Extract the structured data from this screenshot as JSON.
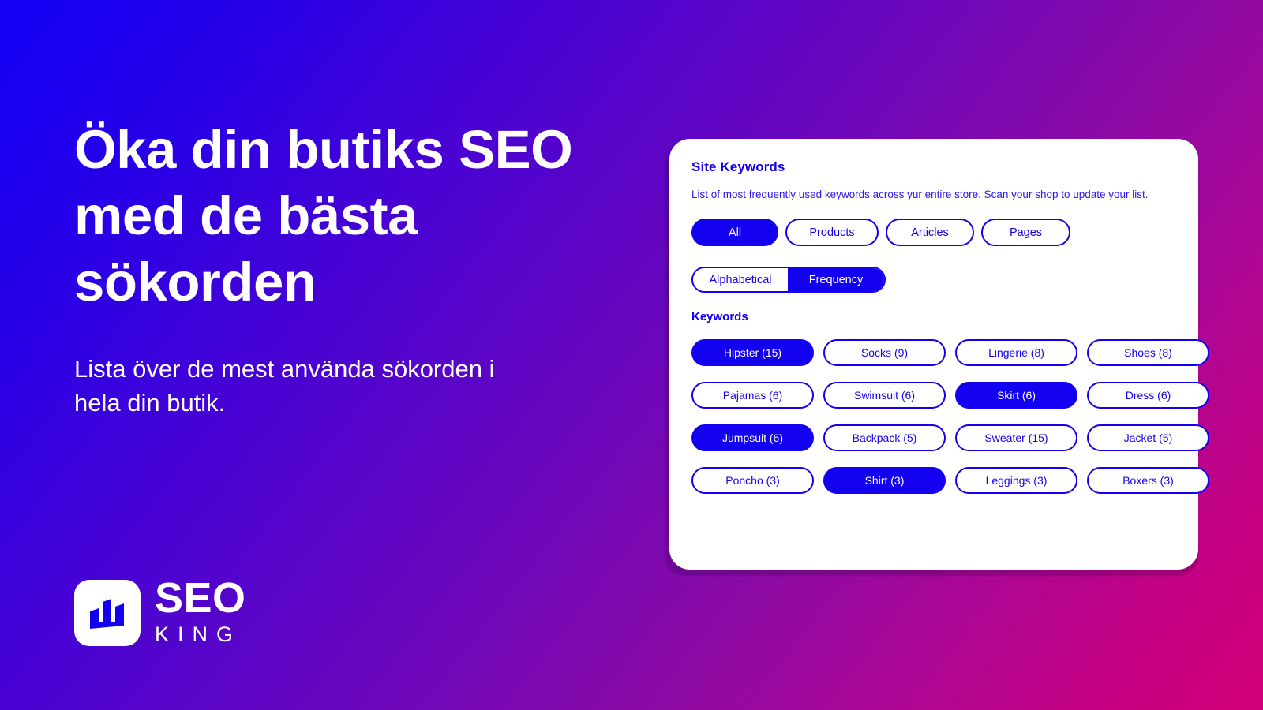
{
  "theme": {
    "accent_blue": "#1400F0",
    "gradient_start": "#1200F6",
    "gradient_mid": "#6A07BD",
    "gradient_end": "#D2007A",
    "card_background": "#FFFFFF",
    "text_white": "#FFFFFF"
  },
  "hero": {
    "headline": "Öka din butiks SEO med de bästa sökorden",
    "subheadline": "Lista över de mest använda sökorden i hela din butik."
  },
  "logo": {
    "mark_icon": "bar-chart-icon",
    "primary_text": "SEO",
    "secondary_text": "KING"
  },
  "card": {
    "title": "Site Keywords",
    "description": "List of most frequently used keywords across yur entire store. Scan your shop to update your list.",
    "filters": [
      {
        "label": "All",
        "active": true
      },
      {
        "label": "Products",
        "active": false
      },
      {
        "label": "Articles",
        "active": false
      },
      {
        "label": "Pages",
        "active": false
      }
    ],
    "sort": [
      {
        "label": "Alphabetical",
        "active": false
      },
      {
        "label": "Frequency",
        "active": true
      }
    ],
    "keywords_label": "Keywords",
    "keywords": [
      {
        "label": "Hipster (15)",
        "term": "Hipster",
        "count": 15,
        "selected": true
      },
      {
        "label": "Socks (9)",
        "term": "Socks",
        "count": 9,
        "selected": false
      },
      {
        "label": "Lingerie (8)",
        "term": "Lingerie",
        "count": 8,
        "selected": false
      },
      {
        "label": "Shoes (8)",
        "term": "Shoes",
        "count": 8,
        "selected": false
      },
      {
        "label": "Pajamas (6)",
        "term": "Pajamas",
        "count": 6,
        "selected": false
      },
      {
        "label": "Swimsuit (6)",
        "term": "Swimsuit",
        "count": 6,
        "selected": false
      },
      {
        "label": "Skirt (6)",
        "term": "Skirt",
        "count": 6,
        "selected": true
      },
      {
        "label": "Dress (6)",
        "term": "Dress",
        "count": 6,
        "selected": false
      },
      {
        "label": "Jumpsuit (6)",
        "term": "Jumpsuit",
        "count": 6,
        "selected": true
      },
      {
        "label": "Backpack (5)",
        "term": "Backpack",
        "count": 5,
        "selected": false
      },
      {
        "label": "Sweater (15)",
        "term": "Sweater",
        "count": 15,
        "selected": false
      },
      {
        "label": "Jacket (5)",
        "term": "Jacket",
        "count": 5,
        "selected": false
      },
      {
        "label": "Poncho (3)",
        "term": "Poncho",
        "count": 3,
        "selected": false
      },
      {
        "label": "Shirt (3)",
        "term": "Shirt",
        "count": 3,
        "selected": true
      },
      {
        "label": "Leggings (3)",
        "term": "Leggings",
        "count": 3,
        "selected": false
      },
      {
        "label": "Boxers (3)",
        "term": "Boxers",
        "count": 3,
        "selected": false
      }
    ]
  }
}
